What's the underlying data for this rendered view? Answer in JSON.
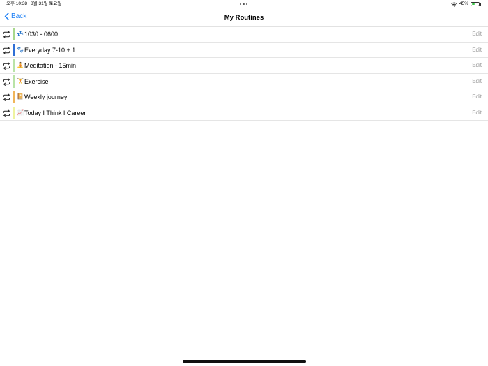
{
  "status_bar": {
    "time": "오후 10:38",
    "date": "8월 31일 토요일",
    "battery_percent": "45%",
    "battery_level": 0.45,
    "battery_fill_color": "#3ec64a"
  },
  "nav": {
    "back_label": "Back",
    "title": "My Routines",
    "accent_color": "#1a7ef5"
  },
  "routines": [
    {
      "emoji": "💤",
      "name": "1030 - 0600",
      "color": "#a8d88c",
      "edit_label": "Edit"
    },
    {
      "emoji": "🐾",
      "name": "Everyday 7-10 + 1",
      "color": "#2f6fd6",
      "edit_label": "Edit"
    },
    {
      "emoji": "🧘",
      "name": "Meditation - 15min",
      "color": "#b9e3a7",
      "edit_label": "Edit"
    },
    {
      "emoji": "🏋",
      "name": "Exercise",
      "color": "#b9e3a7",
      "edit_label": "Edit"
    },
    {
      "emoji": "📔",
      "name": "Weekly journey",
      "color": "#f0b55a",
      "edit_label": "Edit"
    },
    {
      "emoji": "📈",
      "name": "Today I Think I Career",
      "color": "#eef3a0",
      "edit_label": "Edit"
    }
  ]
}
